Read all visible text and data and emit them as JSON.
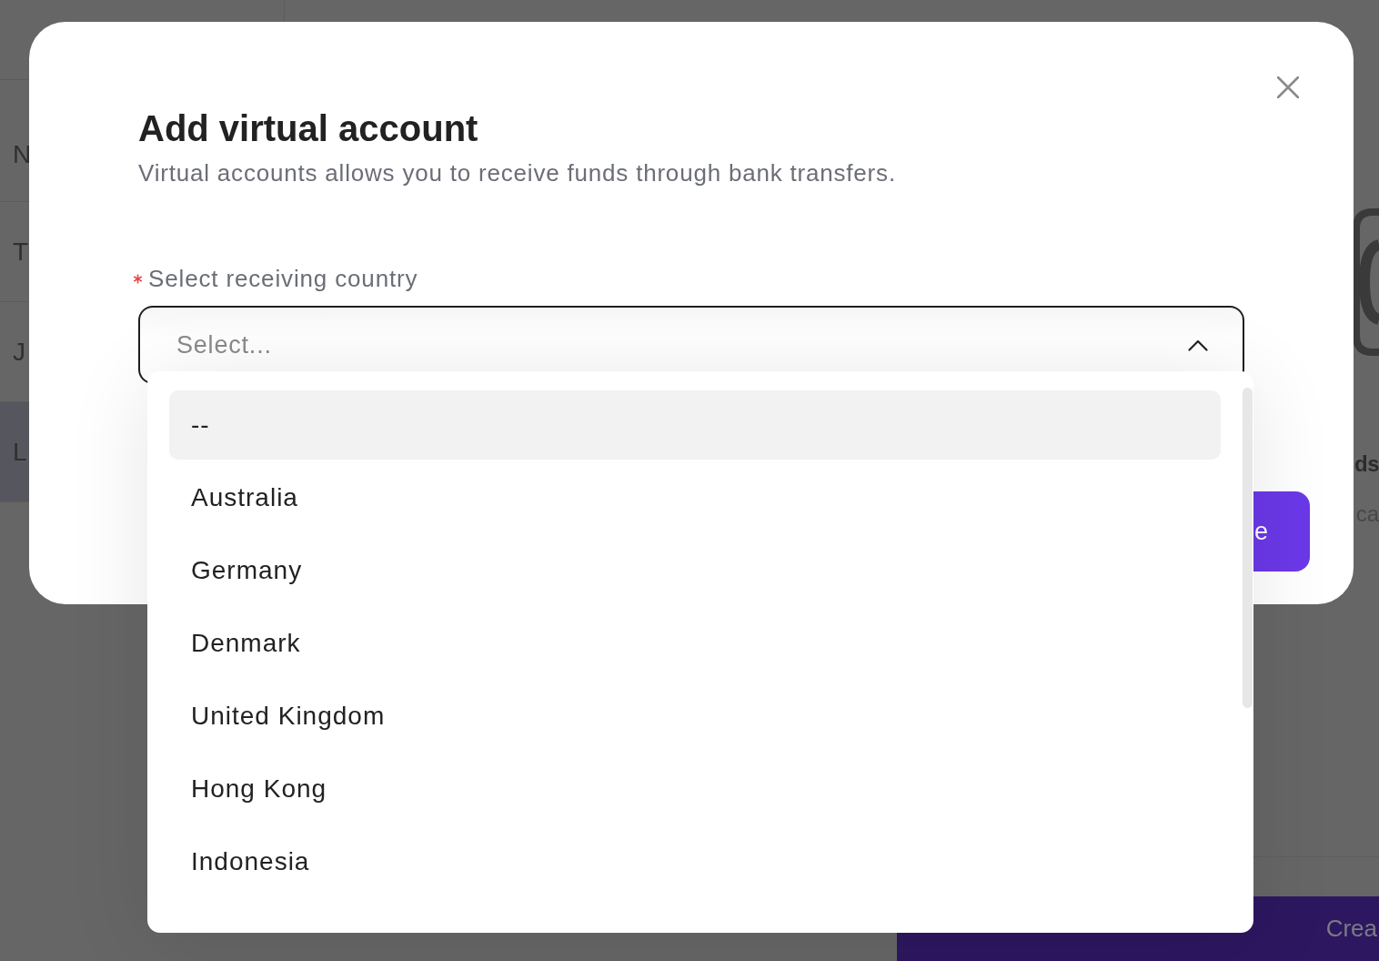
{
  "background": {
    "table": {
      "rows": [
        {
          "text": "N",
          "selected": false
        },
        {
          "text": "T",
          "selected": false
        },
        {
          "text": "J",
          "selected": false
        },
        {
          "text": "L",
          "selected": true
        }
      ]
    },
    "side_panel": {
      "heading": "ds",
      "text": "ca"
    },
    "footer_button": "Crea"
  },
  "dialog": {
    "title": "Add virtual account",
    "subtitle": "Virtual accounts allows you to receive funds through bank transfers.",
    "field": {
      "label": "Select receiving country",
      "required": true,
      "placeholder": "Select...",
      "expanded": true,
      "options": [
        {
          "label": "--",
          "selected": true
        },
        {
          "label": "Australia",
          "selected": false
        },
        {
          "label": "Germany",
          "selected": false
        },
        {
          "label": "Denmark",
          "selected": false
        },
        {
          "label": "United Kingdom",
          "selected": false
        },
        {
          "label": "Hong Kong",
          "selected": false
        },
        {
          "label": "Indonesia",
          "selected": false
        }
      ]
    },
    "footer_button": "e"
  }
}
